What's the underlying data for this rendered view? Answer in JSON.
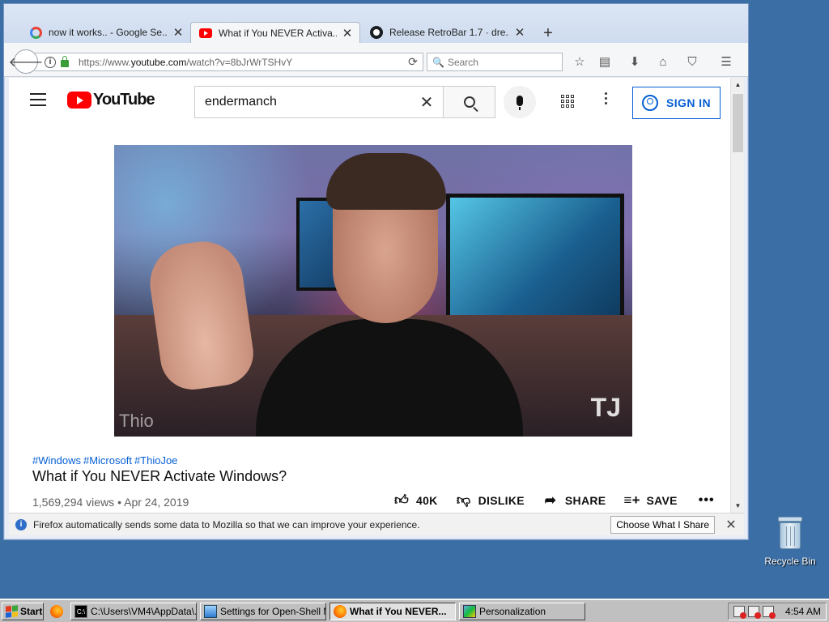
{
  "desktop": {
    "recycle_bin_label": "Recycle Bin"
  },
  "browser": {
    "tabs": [
      {
        "title": "now it works.. - Google Se...",
        "icon": "google-icon",
        "active": false
      },
      {
        "title": "What if You NEVER Activa...",
        "icon": "youtube-icon",
        "active": true
      },
      {
        "title": "Release RetroBar 1.7 · dre...",
        "icon": "github-icon",
        "active": false
      }
    ],
    "new_tab_symbol": "+",
    "url_prefix": "https://www.",
    "url_domain": "youtube.com",
    "url_path": "/watch?v=8bJrWrTSHvY",
    "search_placeholder": "Search",
    "toolbar_icons": [
      "star-icon",
      "reading-list-icon",
      "download-icon",
      "home-icon",
      "pocket-icon",
      "menu-icon"
    ]
  },
  "youtube": {
    "logo_text": "YouTube",
    "search_value": "endermanch",
    "signin_label": "SIGN IN",
    "video": {
      "watermark_left": "Thio",
      "watermark_right": "TJ",
      "hashtags": [
        "#Windows",
        "#Microsoft",
        "#ThioJoe"
      ],
      "title": "What if You NEVER Activate Windows?",
      "views": "1,569,294 views",
      "separator": "•",
      "date": "Apr 24, 2019",
      "likes": "40K",
      "dislike_label": "DISLIKE",
      "share_label": "SHARE",
      "save_label": "SAVE"
    }
  },
  "notification": {
    "message": "Firefox automatically sends some data to Mozilla so that we can improve your experience.",
    "button_label": "Choose What I Share",
    "close_symbol": "✕"
  },
  "taskbar": {
    "start_label": "Start",
    "buttons": [
      {
        "label": "C:\\Users\\VM4\\AppData\\...",
        "icon": "cmd-icon",
        "pressed": false
      },
      {
        "label": "Settings for Open-Shell M...",
        "icon": "settings-icon",
        "pressed": false
      },
      {
        "label": "What if You NEVER...",
        "icon": "firefox-icon",
        "pressed": true
      },
      {
        "label": "Personalization",
        "icon": "personalization-icon",
        "pressed": false
      }
    ],
    "clock": "4:54 AM",
    "cmd_icon_text": "C:\\"
  }
}
